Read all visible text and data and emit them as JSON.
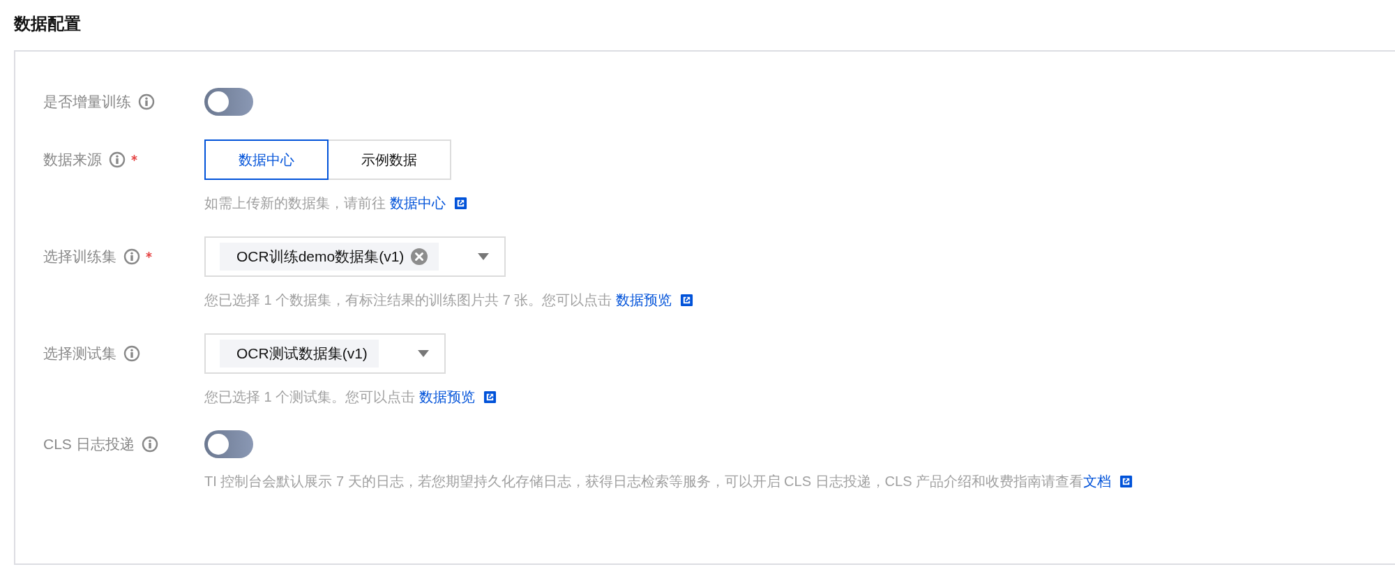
{
  "section_title": "数据配置",
  "fields": [
    {
      "kind": "switch",
      "label": "是否增量训练",
      "required": false,
      "on": false
    },
    {
      "kind": "segmented",
      "label": "数据来源",
      "required": true,
      "options": [
        {
          "label": "数据中心",
          "selected": true
        },
        {
          "label": "示例数据",
          "selected": false
        }
      ],
      "hint": {
        "text": "如需上传新的数据集，请前往 ",
        "link": "数据中心"
      }
    },
    {
      "kind": "select",
      "label": "选择训练集",
      "required": true,
      "tag": "OCR训练demo数据集(v1)",
      "removable": true,
      "hint": {
        "text": "您已选择 1 个数据集，有标注结果的训练图片共 7 张。您可以点击 ",
        "link": "数据预览"
      }
    },
    {
      "kind": "select",
      "label": "选择测试集",
      "required": false,
      "tag": "OCR测试数据集(v1)",
      "removable": false,
      "hint": {
        "text": "您已选择 1 个测试集。您可以点击 ",
        "link": "数据预览"
      }
    },
    {
      "kind": "switch",
      "label": "CLS 日志投递",
      "required": false,
      "on": false,
      "hint": {
        "text": "TI 控制台会默认展示 7 天的日志，若您期望持久化存储日志，获得日志检索等服务，可以开启 CLS 日志投递，CLS 产品介绍和收费指南请查看",
        "link": "文档"
      }
    }
  ]
}
